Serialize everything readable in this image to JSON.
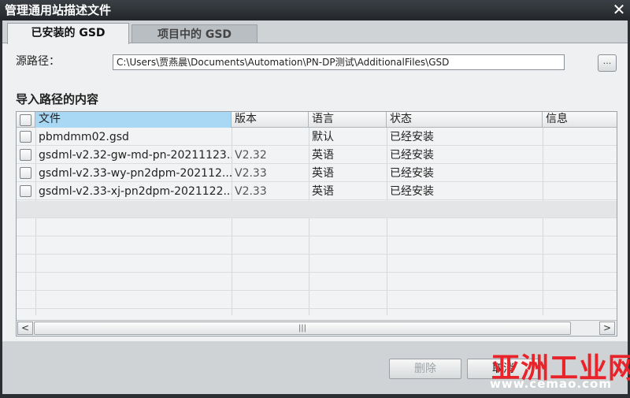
{
  "window": {
    "title": "管理通用站描述文件",
    "close_glyph": "✕"
  },
  "tabs": [
    {
      "label": "已安装的 GSD",
      "active": true
    },
    {
      "label": "项目中的 GSD",
      "active": false
    }
  ],
  "source": {
    "label": "源路径：",
    "value": "C:\\Users\\贾燕晨\\Documents\\Automation\\PN-DP测试\\AdditionalFiles\\GSD",
    "browse_label": "..."
  },
  "content": {
    "title": "导入路径的内容",
    "columns": [
      "文件",
      "版本",
      "语言",
      "状态",
      "信息"
    ],
    "rows": [
      {
        "file": "pbmdmm02.gsd",
        "version": "",
        "language": "默认",
        "status": "已经安装",
        "info": ""
      },
      {
        "file": "gsdml-v2.32-gw-md-pn-20211123...",
        "version": "V2.32",
        "language": "英语",
        "status": "已经安装",
        "info": ""
      },
      {
        "file": "gsdml-v2.33-wy-pn2dpm-202112...",
        "version": "V2.33",
        "language": "英语",
        "status": "已经安装",
        "info": ""
      },
      {
        "file": "gsdml-v2.33-xj-pn2dpm-2021122...",
        "version": "V2.33",
        "language": "英语",
        "status": "已经安装",
        "info": ""
      }
    ],
    "scroll_left": "<",
    "scroll_right": ">",
    "scroll_grip": "|||"
  },
  "footer": {
    "delete_label": "删除",
    "close_label": "取消"
  },
  "watermark": {
    "text_cn": "亚洲工业网",
    "url": "www.cemao.com"
  },
  "colors": {
    "titlebar": "#2b2f33",
    "header_selected": "#a9d8f5",
    "watermark_red": "#e8232a"
  }
}
